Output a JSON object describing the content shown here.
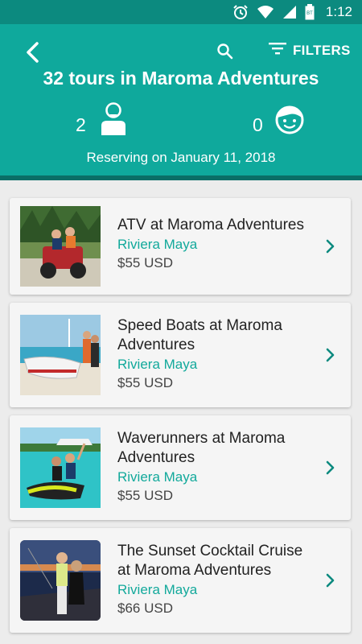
{
  "status_bar": {
    "time": "1:12"
  },
  "header": {
    "filters_label": "FILTERS",
    "title": "32 tours in Maroma Adventures",
    "adults": "2",
    "children": "0",
    "reserving": "Reserving on January 11, 2018"
  },
  "tours": [
    {
      "name": "ATV at Maroma Adventures",
      "location": "Riviera Maya",
      "price": "$55 USD"
    },
    {
      "name": "Speed Boats at Maroma Adventures",
      "location": "Riviera Maya",
      "price": "$55 USD"
    },
    {
      "name": "Waverunners at Maroma Adventures",
      "location": "Riviera Maya",
      "price": "$55 USD"
    },
    {
      "name": "The Sunset Cocktail Cruise at Maroma Adventures",
      "location": "Riviera Maya",
      "price": "$66 USD"
    }
  ],
  "colors": {
    "header": "#0fa99c",
    "status_bar": "#0c8a7f",
    "accent": "#12a99b"
  },
  "icons": [
    "alarm-icon",
    "wifi-icon",
    "signal-icon",
    "battery-icon",
    "back-arrow-icon",
    "search-icon",
    "filter-icon",
    "adult-icon",
    "child-icon",
    "chevron-right-icon"
  ]
}
